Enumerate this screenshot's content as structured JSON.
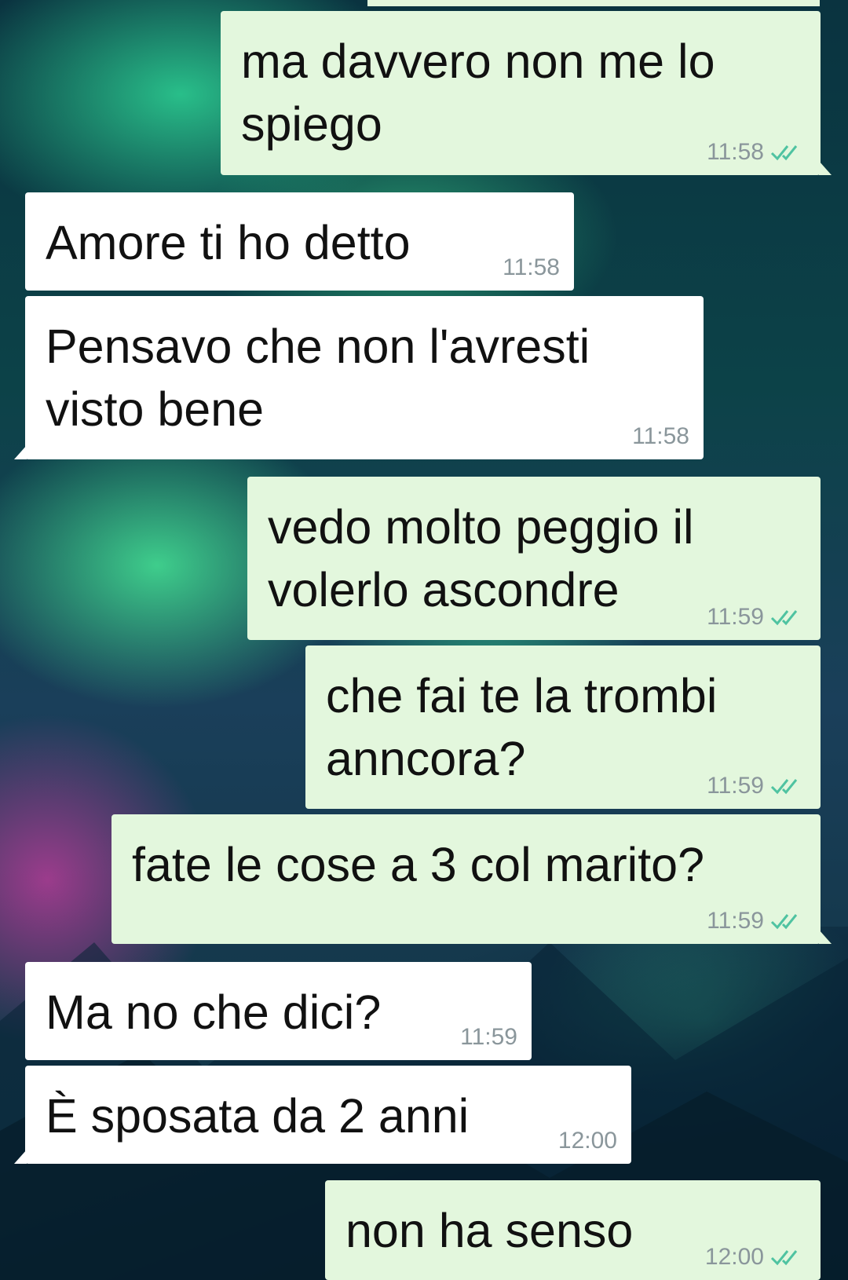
{
  "messages": [
    {
      "direction": "out",
      "text": "ma davvero non me lo\nspiego",
      "time": "11:58",
      "read": true
    },
    {
      "direction": "in",
      "text": "Amore ti ho detto",
      "time": "11:58"
    },
    {
      "direction": "in",
      "text": "Pensavo che non l'avresti\nvisto bene",
      "time": "11:58"
    },
    {
      "direction": "out",
      "text": "vedo molto peggio il\nvolerlo ascondre",
      "time": "11:59",
      "read": true
    },
    {
      "direction": "out",
      "text": "che fai te la trombi\nanncora?",
      "time": "11:59",
      "read": true
    },
    {
      "direction": "out",
      "text": "fate le cose a 3 col marito?",
      "time": "11:59",
      "read": true
    },
    {
      "direction": "in",
      "text": "Ma no che dici?",
      "time": "11:59"
    },
    {
      "direction": "in",
      "text": "È sposata da 2 anni",
      "time": "12:00"
    },
    {
      "direction": "out",
      "text": "non ha senso",
      "time": "12:00",
      "read": true
    }
  ],
  "icons": {
    "read_receipt": "double-check-icon"
  },
  "colors": {
    "incoming_bubble": "#ffffff",
    "outgoing_bubble": "#e3f7dd",
    "read_check": "#4fc3a1",
    "timestamp": "#8a969b"
  }
}
